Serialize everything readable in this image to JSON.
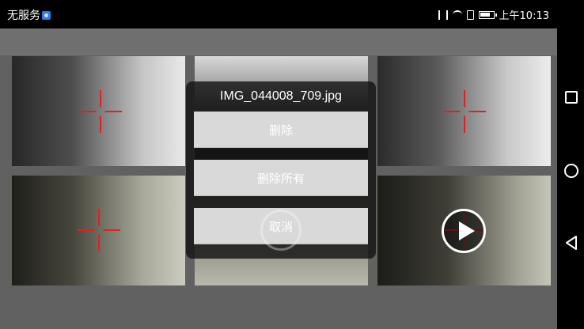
{
  "status_bar": {
    "carrier_text": "无服务",
    "time": "上午10:13",
    "icons": [
      "carrier-badge-icon",
      "vibrate-icon",
      "wifi-icon",
      "sim-icon",
      "battery-icon"
    ]
  },
  "gallery": {
    "thumbnails": [
      {
        "type": "photo",
        "overlay": "crosshair"
      },
      {
        "type": "photo",
        "overlay": "none"
      },
      {
        "type": "photo",
        "overlay": "crosshair"
      },
      {
        "type": "photo",
        "overlay": "crosshair"
      },
      {
        "type": "photo",
        "overlay": "none"
      },
      {
        "type": "video",
        "overlay": "play-icon"
      }
    ]
  },
  "dialog": {
    "title": "IMG_044008_709.jpg",
    "delete_label": "删除",
    "delete_all_label": "删除所有",
    "cancel_label": "取消"
  },
  "nav_bar": {
    "buttons": [
      "recent-apps-icon",
      "home-icon",
      "back-icon"
    ]
  },
  "colors": {
    "background": "#616161",
    "button_bg": "#d9d9d9",
    "crosshair": "#dd2222",
    "dialog_bg": "#141414"
  }
}
